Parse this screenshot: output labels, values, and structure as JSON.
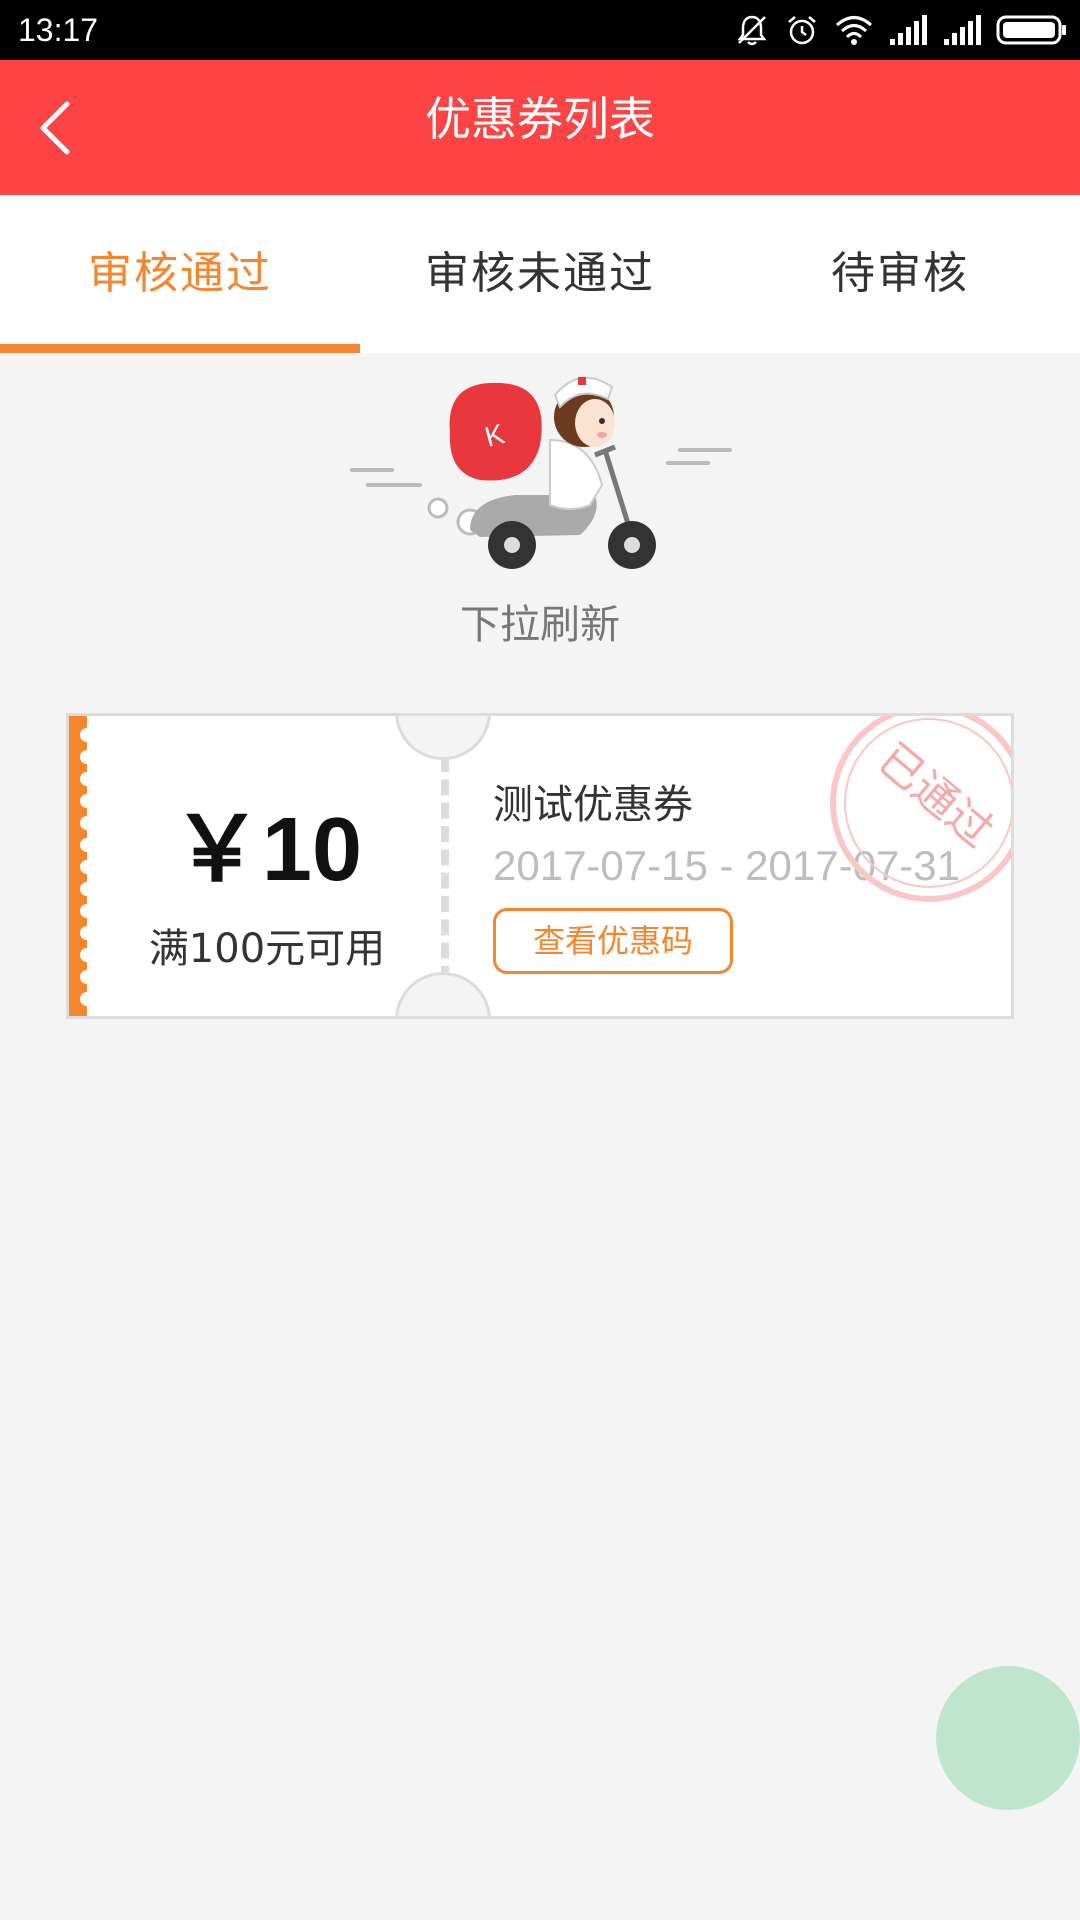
{
  "status_bar": {
    "time": "13:17"
  },
  "header": {
    "title": "优惠券列表"
  },
  "tabs": [
    {
      "label": "审核通过",
      "active": true
    },
    {
      "label": "审核未通过",
      "active": false
    },
    {
      "label": "待审核",
      "active": false
    }
  ],
  "refresh": {
    "text": "下拉刷新"
  },
  "coupon": {
    "amount": "￥10",
    "condition": "满100元可用",
    "name": "测试优惠券",
    "dates": "2017-07-15 - 2017-07-31",
    "view_code_label": "查看优惠码",
    "stamp_text": "已通过"
  },
  "colors": {
    "header": "#fd4444",
    "accent": "#f5862d",
    "stamp": "#fbc6c6",
    "floating_button": "#bfe5cf"
  },
  "icons": {
    "back": "chevron-left-icon",
    "mute": "bell-off-icon",
    "alarm": "alarm-icon",
    "wifi": "wifi-icon",
    "signal": "signal-icon",
    "battery": "battery-icon"
  }
}
